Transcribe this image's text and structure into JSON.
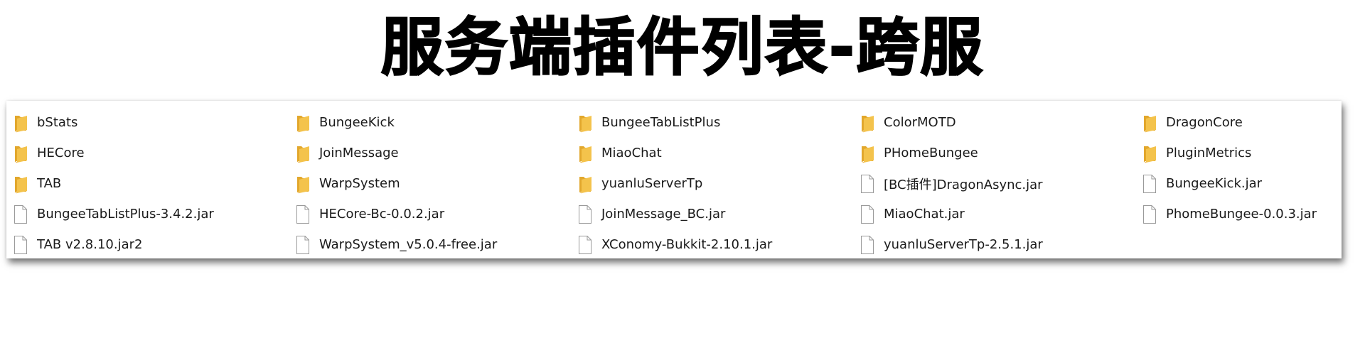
{
  "title": "服务端插件列表-跨服",
  "colors": {
    "folder": "#f4c34c",
    "folder_dark": "#e2a72c",
    "file_border": "#9a9a9a"
  },
  "items": [
    {
      "name": "bStats",
      "type": "folder",
      "icon": "folder-icon"
    },
    {
      "name": "BungeeKick",
      "type": "folder",
      "icon": "folder-icon"
    },
    {
      "name": "BungeeTabListPlus",
      "type": "folder",
      "icon": "folder-icon"
    },
    {
      "name": "ColorMOTD",
      "type": "folder",
      "icon": "folder-icon"
    },
    {
      "name": "DragonCore",
      "type": "folder",
      "icon": "folder-icon"
    },
    {
      "name": "HECore",
      "type": "folder",
      "icon": "folder-icon"
    },
    {
      "name": "JoinMessage",
      "type": "folder",
      "icon": "folder-icon"
    },
    {
      "name": "MiaoChat",
      "type": "folder",
      "icon": "folder-icon"
    },
    {
      "name": "PHomeBungee",
      "type": "folder",
      "icon": "folder-icon"
    },
    {
      "name": "PluginMetrics",
      "type": "folder",
      "icon": "folder-icon"
    },
    {
      "name": "TAB",
      "type": "folder",
      "icon": "folder-icon"
    },
    {
      "name": "WarpSystem",
      "type": "folder",
      "icon": "folder-icon"
    },
    {
      "name": "yuanluServerTp",
      "type": "folder",
      "icon": "folder-icon"
    },
    {
      "name": "[BC插件]DragonAsync.jar",
      "type": "file",
      "icon": "file-icon"
    },
    {
      "name": "BungeeKick.jar",
      "type": "file",
      "icon": "file-icon"
    },
    {
      "name": "BungeeTabListPlus-3.4.2.jar",
      "type": "file",
      "icon": "file-icon"
    },
    {
      "name": "HECore-Bc-0.0.2.jar",
      "type": "file",
      "icon": "file-icon"
    },
    {
      "name": "JoinMessage_BC.jar",
      "type": "file",
      "icon": "file-icon"
    },
    {
      "name": "MiaoChat.jar",
      "type": "file",
      "icon": "file-icon"
    },
    {
      "name": "PhomeBungee-0.0.3.jar",
      "type": "file",
      "icon": "file-icon"
    },
    {
      "name": "TAB v2.8.10.jar2",
      "type": "file",
      "icon": "file-icon"
    },
    {
      "name": "WarpSystem_v5.0.4-free.jar",
      "type": "file",
      "icon": "file-icon"
    },
    {
      "name": "XConomy-Bukkit-2.10.1.jar",
      "type": "file",
      "icon": "file-icon"
    },
    {
      "name": "yuanluServerTp-2.5.1.jar",
      "type": "file",
      "icon": "file-icon"
    }
  ]
}
